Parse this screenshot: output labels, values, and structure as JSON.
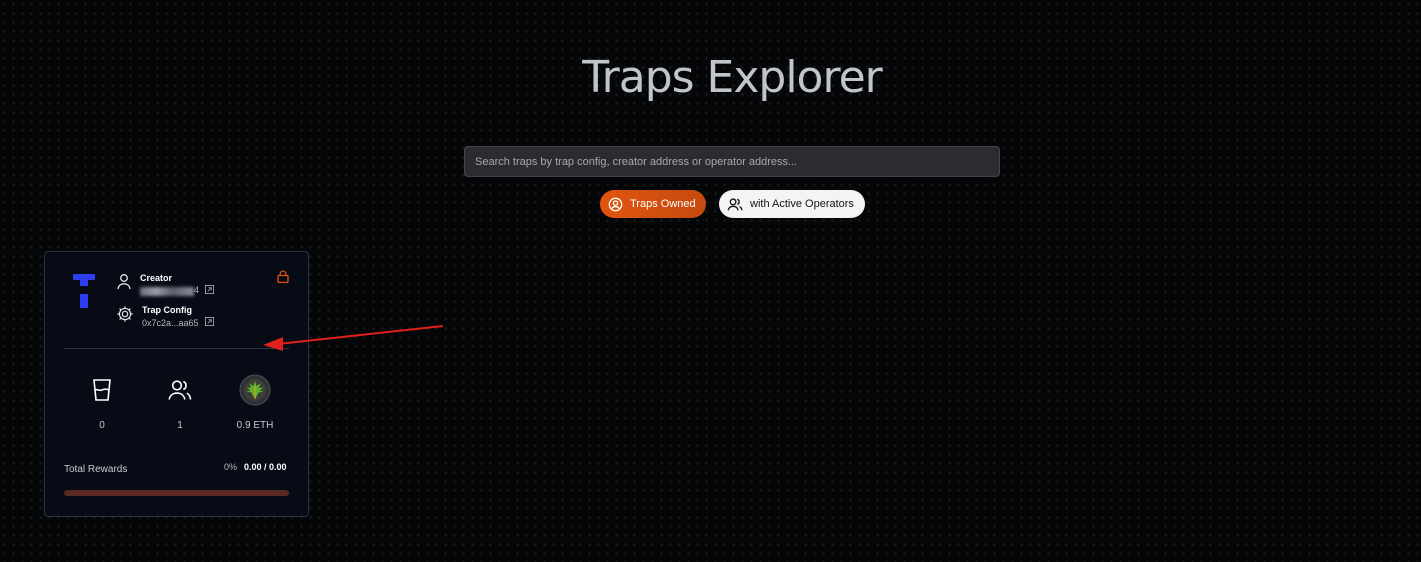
{
  "page": {
    "title": "Traps Explorer"
  },
  "search": {
    "placeholder": "Search traps by trap config, creator address or operator address..."
  },
  "filters": [
    {
      "label": "Traps Owned",
      "icon": "user-circle-icon",
      "active": true
    },
    {
      "label": "with Active Operators",
      "icon": "users-icon",
      "active": false
    }
  ],
  "colors": {
    "accent": "#e1550f",
    "background": "#050608",
    "card_bg": "#070b16",
    "logo_blue": "#2d3ef0",
    "annotation_arrow": "#e0201d"
  },
  "trap_card": {
    "logo_icon": "trap-logo-icon",
    "creator": {
      "label": "Creator",
      "address_suffix": "4",
      "icon": "user-icon"
    },
    "trap_config": {
      "label": "Trap Config",
      "address": "0x7c2a...aa65",
      "icon": "gear-icon"
    },
    "lock_icon": "lock-icon",
    "stats": [
      {
        "icon": "glass-icon",
        "value": "0"
      },
      {
        "icon": "operators-icon",
        "value": "1"
      },
      {
        "icon": "token-avatar-icon",
        "value": "0.9 ETH"
      }
    ],
    "rewards": {
      "label": "Total Rewards",
      "percent_text": "0%",
      "amount_text": "0.00 / 0.00",
      "progress_fraction": 0
    }
  }
}
